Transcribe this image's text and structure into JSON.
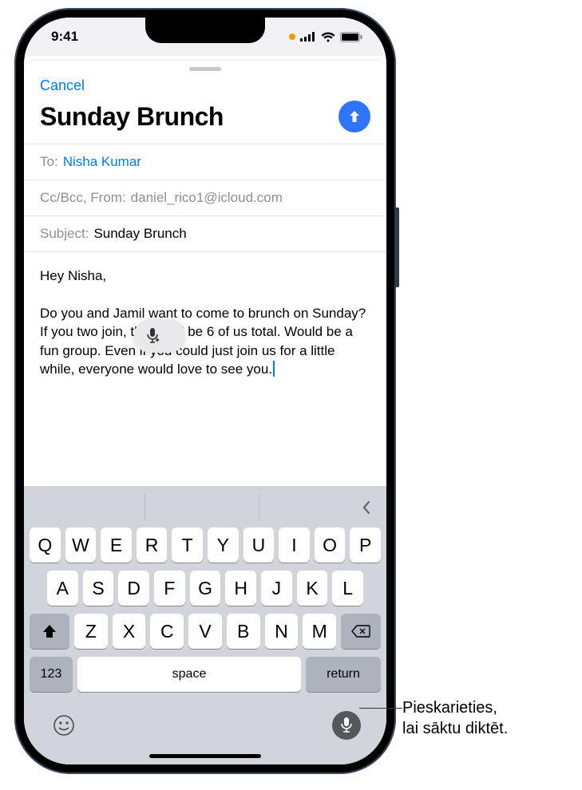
{
  "status": {
    "time": "9:41"
  },
  "sheet": {
    "cancel": "Cancel",
    "title": "Sunday Brunch",
    "to_label": "To:",
    "to_value": "Nisha Kumar",
    "cc_label": "Cc/Bcc, From:",
    "cc_value": "daniel_rico1@icloud.com",
    "subject_label": "Subject:",
    "subject_value": "Sunday Brunch",
    "body_greeting": "Hey Nisha,",
    "body_para": "Do you and Jamil want to come to brunch on Sunday? If you two join, there will be 6 of us total. Would be a fun group. Even if you could just join us for a little while, everyone would love to see you."
  },
  "keyboard": {
    "row1": [
      "Q",
      "W",
      "E",
      "R",
      "T",
      "Y",
      "U",
      "I",
      "O",
      "P"
    ],
    "row2": [
      "A",
      "S",
      "D",
      "F",
      "G",
      "H",
      "J",
      "K",
      "L"
    ],
    "row3": [
      "Z",
      "X",
      "C",
      "V",
      "B",
      "N",
      "M"
    ],
    "key_123": "123",
    "key_space": "space",
    "key_return": "return"
  },
  "callout": {
    "line1": "Pieskarieties,",
    "line2": "lai sāktu diktēt."
  }
}
